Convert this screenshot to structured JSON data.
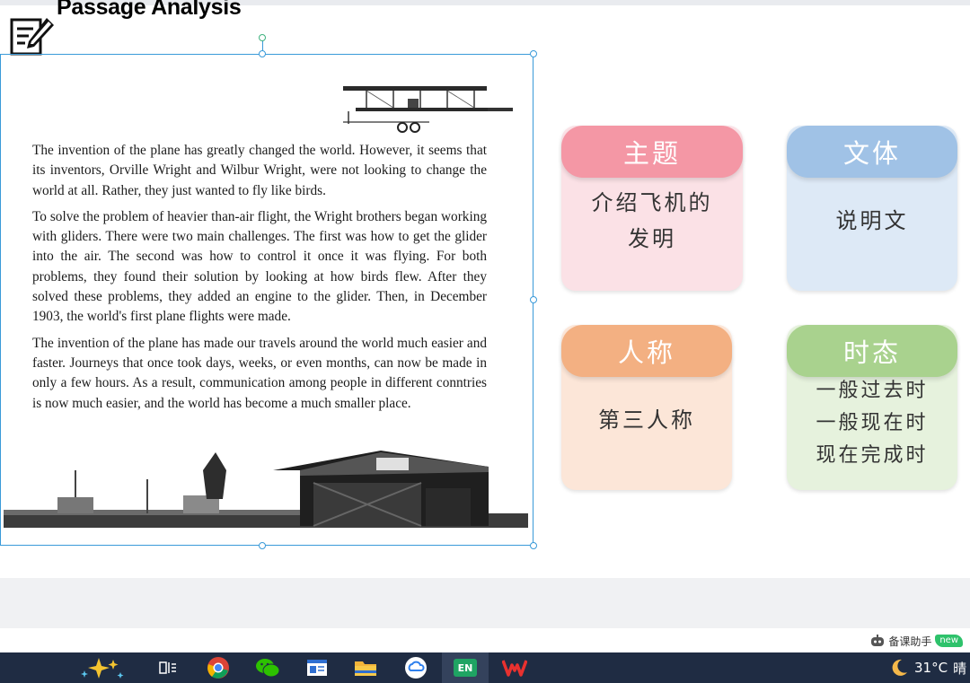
{
  "slide": {
    "title": "Passage Analysis",
    "passage": [
      "The invention of the plane has greatly changed the world. However, it seems that its inventors, Orville Wright and Wilbur Wright, were not looking to change the world at all. Rather, they just wanted to fly like birds.",
      "To solve the problem of heavier than-air flight, the Wright brothers began working with gliders. There were two main challenges. The first was how to get the glider into the air. The second was how to control it once it was flying. For both problems, they found their solution by looking at how birds flew. After they solved these problems, they added an engine to the glider. Then, in December 1903, the world's first plane flights were made.",
      "The invention of the plane has made our travels around the world much easier and faster. Journeys that once took days, weeks, or even months, can now be made in only a few hours. As a result, communication among people in different conntries is now much easier, and the world has become a much smaller place."
    ],
    "cards": [
      {
        "header": "主题",
        "lines": [
          "介绍飞机的",
          "发明"
        ],
        "header_color": "#f497a5",
        "body_color": "#fbe1e6"
      },
      {
        "header": "文体",
        "lines": [
          "说明文"
        ],
        "header_color": "#a0c2e6",
        "body_color": "#dde9f6"
      },
      {
        "header": "人称",
        "lines": [
          "第三人称"
        ],
        "header_color": "#f3b082",
        "body_color": "#fce6d8"
      },
      {
        "header": "时态",
        "lines": [
          "一般过去时",
          "一般现在时",
          "现在完成时"
        ],
        "header_color": "#a9d28e",
        "body_color": "#e6f2dd"
      }
    ]
  },
  "status": {
    "assistant_label": "备课助手",
    "assistant_badge": "new"
  },
  "taskbar": {
    "icons": [
      "sparkle-icon",
      "task-view-icon",
      "chrome-icon",
      "wechat-icon",
      "reader-icon",
      "folder-icon",
      "cloud-icon",
      "en-app-icon",
      "wps-icon"
    ],
    "en_label": "EN",
    "temperature": "31°C",
    "weather_text": "晴"
  }
}
